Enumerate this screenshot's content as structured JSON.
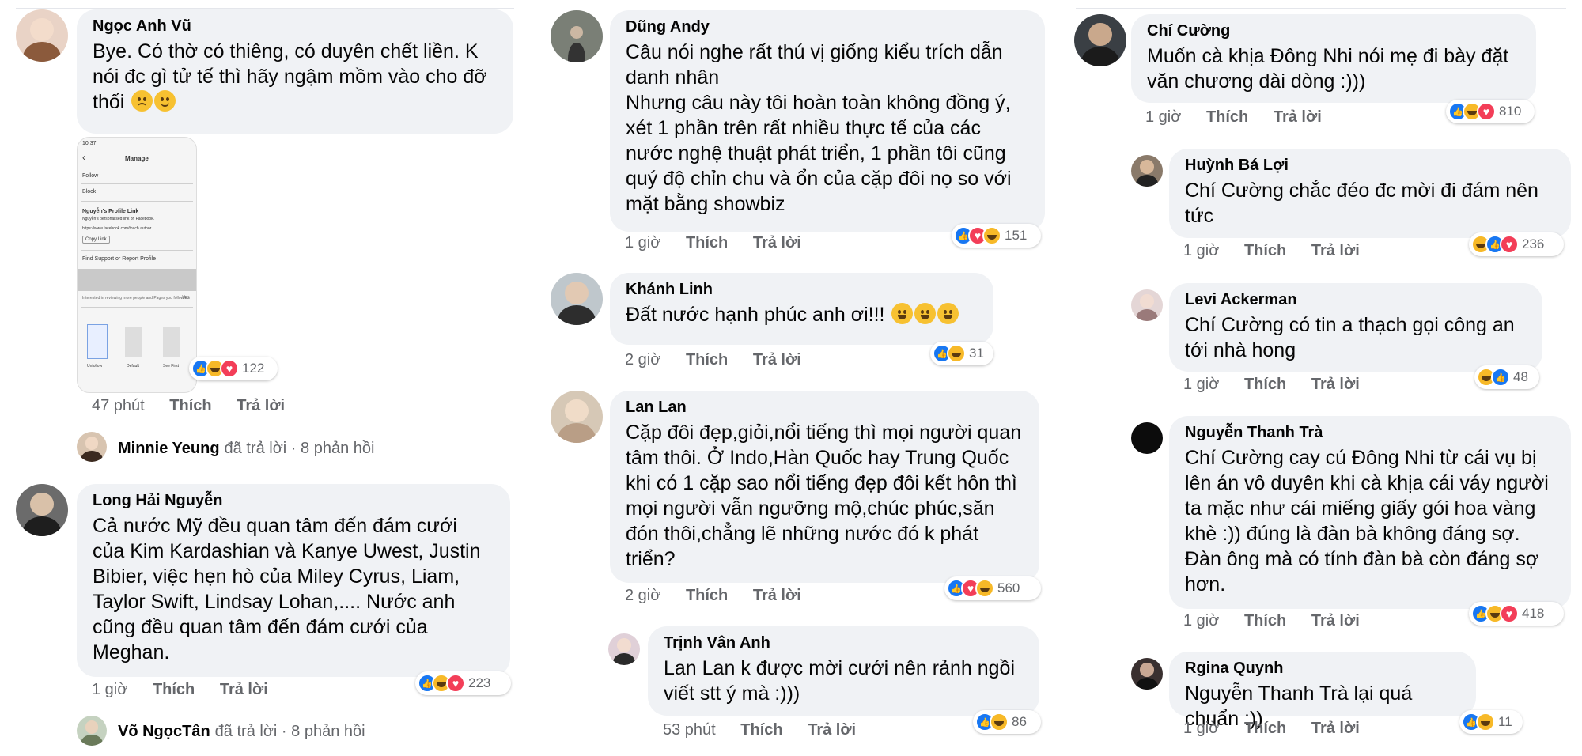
{
  "columns": [
    {
      "comments": [
        {
          "author": "Ngọc Anh Vũ",
          "text": "Bye. Có thờ có thiêng, có duyên chết liền. K nói đc gì tử tế thì hãy ngậm mồm vào cho đỡ thối",
          "emojis": [
            "updown-face",
            "smile-face"
          ],
          "time": "47 phút",
          "like": "Thích",
          "reply": "Trả lời",
          "reactions": [
            "like",
            "haha",
            "love"
          ],
          "count": "122",
          "attachment": {
            "screen_title": "Manage",
            "status_time": "10:37",
            "items": [
              "Follow",
              "Block",
              "Nguyễn's Profile Link",
              "Nguyễn's personalised link on Facebook.",
              "https://www.facebook.com/thach.author",
              "Copy Link",
              "Find Support or Report Profile"
            ],
            "footer_text": "Interested in reviewing more people and Pages you follow?",
            "footer_action": "Yes",
            "options": [
              "Unfollow",
              "Default",
              "See First"
            ]
          },
          "replies_summary": {
            "name": "Minnie Yeung",
            "text": "đã trả lời · 8 phản hồi"
          }
        },
        {
          "author": "Long Hải Nguyễn",
          "text": "Cả nước Mỹ đều quan tâm đến đám cưới của Kim Kardashian và Kanye Uwest, Justin Bibier, việc hẹn hò của Miley Cyrus, Liam, Taylor Swift, Lindsay Lohan,.... Nước anh cũng đều quan tâm đến đám cưới của Meghan.",
          "time": "1 giờ",
          "like": "Thích",
          "reply": "Trả lời",
          "reactions": [
            "like",
            "haha",
            "love"
          ],
          "count": "223",
          "replies_summary": {
            "name": "Võ NgọcTân",
            "text": "đã trả lời · 8 phản hồi"
          }
        }
      ]
    },
    {
      "comments": [
        {
          "author": "Dũng Andy",
          "text": "Câu nói nghe rất thú vị giống kiểu trích dẫn danh nhân\nNhưng câu này tôi hoàn toàn không đồng ý, xét 1 phần trên rất nhiều thực tế của các nước nghệ thuật phát triển, 1 phần tôi cũng quý độ chỉn chu và ổn của cặp đôi nọ so với mặt bằng showbiz",
          "time": "1 giờ",
          "like": "Thích",
          "reply": "Trả lời",
          "reactions": [
            "like",
            "love",
            "haha"
          ],
          "count": "151"
        },
        {
          "author": "Khánh Linh",
          "text": "Đất nước hạnh phúc anh ơi!!!",
          "emojis": [
            "rofl-face",
            "rofl-face",
            "rofl-face"
          ],
          "time": "2 giờ",
          "like": "Thích",
          "reply": "Trả lời",
          "reactions": [
            "like",
            "haha"
          ],
          "count": "31"
        },
        {
          "author": "Lan Lan",
          "text": "Cặp đôi đẹp,giỏi,nổi tiếng thì mọi người quan tâm thôi. Ở Indo,Hàn Quốc hay Trung Quốc khi có 1 cặp sao nổi tiếng đẹp đôi kết hôn thì mọi người vẫn ngưỡng mộ,chúc phúc,săn đón thôi,chẳng lẽ những nước đó k phát triển?",
          "time": "2 giờ",
          "like": "Thích",
          "reply": "Trả lời",
          "reactions": [
            "like",
            "love",
            "haha"
          ],
          "count": "560"
        },
        {
          "author": "Trịnh Vân Anh",
          "text": "Lan Lan k được mời cưới nên rảnh ngồi viết stt ý mà :)))",
          "time": "53 phút",
          "like": "Thích",
          "reply": "Trả lời",
          "reactions": [
            "like",
            "haha"
          ],
          "count": "86"
        }
      ]
    },
    {
      "comments": [
        {
          "author": "Chí Cường",
          "text": "Muốn cà khịa Đông Nhi nói mẹ đi bày đặt văn chương dài dòng :)))",
          "time": "1 giờ",
          "like": "Thích",
          "reply": "Trả lời",
          "reactions": [
            "like",
            "haha",
            "love"
          ],
          "count": "810"
        },
        {
          "author": "Huỳnh Bá Lợi",
          "text": "Chí Cường chắc đéo đc mời đi đám nên tức",
          "time": "1 giờ",
          "like": "Thích",
          "reply": "Trả lời",
          "reactions": [
            "haha",
            "like",
            "love"
          ],
          "count": "236"
        },
        {
          "author": "Levi Ackerman",
          "text": "Chí Cường có tin a thạch gọi công an tới nhà hong",
          "time": "1 giờ",
          "like": "Thích",
          "reply": "Trả lời",
          "reactions": [
            "haha",
            "like"
          ],
          "count": "48"
        },
        {
          "author": "Nguyễn Thanh Trà",
          "text": "Chí Cường cay cú Đông Nhi từ cái vụ bị lên án vô duyên khi cà khịa cái váy người ta mặc như cái miếng giấy gói hoa vàng khè :)) đúng là đàn bà không đáng sợ. Đàn ông mà có tính đàn bà còn đáng sợ hơn.",
          "time": "1 giờ",
          "like": "Thích",
          "reply": "Trả lời",
          "reactions": [
            "like",
            "haha",
            "love"
          ],
          "count": "418"
        },
        {
          "author": "Rgina Quynh",
          "text": "Nguyễn Thanh Trà lại quá chuẩn :))",
          "time": "1 giờ",
          "like": "Thích",
          "reply": "Trả lời",
          "reactions": [
            "like",
            "haha"
          ],
          "count": "11"
        }
      ]
    }
  ],
  "colors": {
    "bubble": "#f0f2f5",
    "meta": "#65676b",
    "like": "#1877f2",
    "love": "#f33e58",
    "haha": "#f7b928"
  }
}
